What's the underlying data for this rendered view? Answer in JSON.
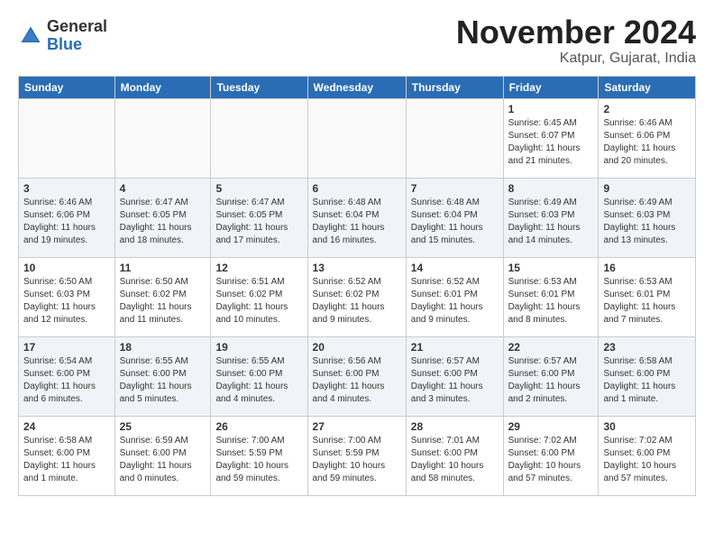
{
  "header": {
    "logo_line1": "General",
    "logo_line2": "Blue",
    "title": "November 2024",
    "subtitle": "Katpur, Gujarat, India"
  },
  "calendar": {
    "days_of_week": [
      "Sunday",
      "Monday",
      "Tuesday",
      "Wednesday",
      "Thursday",
      "Friday",
      "Saturday"
    ],
    "weeks": [
      [
        {
          "day": "",
          "empty": true
        },
        {
          "day": "",
          "empty": true
        },
        {
          "day": "",
          "empty": true
        },
        {
          "day": "",
          "empty": true
        },
        {
          "day": "",
          "empty": true
        },
        {
          "day": "1",
          "sunrise": "Sunrise: 6:45 AM",
          "sunset": "Sunset: 6:07 PM",
          "daylight": "Daylight: 11 hours and 21 minutes."
        },
        {
          "day": "2",
          "sunrise": "Sunrise: 6:46 AM",
          "sunset": "Sunset: 6:06 PM",
          "daylight": "Daylight: 11 hours and 20 minutes."
        }
      ],
      [
        {
          "day": "3",
          "sunrise": "Sunrise: 6:46 AM",
          "sunset": "Sunset: 6:06 PM",
          "daylight": "Daylight: 11 hours and 19 minutes."
        },
        {
          "day": "4",
          "sunrise": "Sunrise: 6:47 AM",
          "sunset": "Sunset: 6:05 PM",
          "daylight": "Daylight: 11 hours and 18 minutes."
        },
        {
          "day": "5",
          "sunrise": "Sunrise: 6:47 AM",
          "sunset": "Sunset: 6:05 PM",
          "daylight": "Daylight: 11 hours and 17 minutes."
        },
        {
          "day": "6",
          "sunrise": "Sunrise: 6:48 AM",
          "sunset": "Sunset: 6:04 PM",
          "daylight": "Daylight: 11 hours and 16 minutes."
        },
        {
          "day": "7",
          "sunrise": "Sunrise: 6:48 AM",
          "sunset": "Sunset: 6:04 PM",
          "daylight": "Daylight: 11 hours and 15 minutes."
        },
        {
          "day": "8",
          "sunrise": "Sunrise: 6:49 AM",
          "sunset": "Sunset: 6:03 PM",
          "daylight": "Daylight: 11 hours and 14 minutes."
        },
        {
          "day": "9",
          "sunrise": "Sunrise: 6:49 AM",
          "sunset": "Sunset: 6:03 PM",
          "daylight": "Daylight: 11 hours and 13 minutes."
        }
      ],
      [
        {
          "day": "10",
          "sunrise": "Sunrise: 6:50 AM",
          "sunset": "Sunset: 6:03 PM",
          "daylight": "Daylight: 11 hours and 12 minutes."
        },
        {
          "day": "11",
          "sunrise": "Sunrise: 6:50 AM",
          "sunset": "Sunset: 6:02 PM",
          "daylight": "Daylight: 11 hours and 11 minutes."
        },
        {
          "day": "12",
          "sunrise": "Sunrise: 6:51 AM",
          "sunset": "Sunset: 6:02 PM",
          "daylight": "Daylight: 11 hours and 10 minutes."
        },
        {
          "day": "13",
          "sunrise": "Sunrise: 6:52 AM",
          "sunset": "Sunset: 6:02 PM",
          "daylight": "Daylight: 11 hours and 9 minutes."
        },
        {
          "day": "14",
          "sunrise": "Sunrise: 6:52 AM",
          "sunset": "Sunset: 6:01 PM",
          "daylight": "Daylight: 11 hours and 9 minutes."
        },
        {
          "day": "15",
          "sunrise": "Sunrise: 6:53 AM",
          "sunset": "Sunset: 6:01 PM",
          "daylight": "Daylight: 11 hours and 8 minutes."
        },
        {
          "day": "16",
          "sunrise": "Sunrise: 6:53 AM",
          "sunset": "Sunset: 6:01 PM",
          "daylight": "Daylight: 11 hours and 7 minutes."
        }
      ],
      [
        {
          "day": "17",
          "sunrise": "Sunrise: 6:54 AM",
          "sunset": "Sunset: 6:00 PM",
          "daylight": "Daylight: 11 hours and 6 minutes."
        },
        {
          "day": "18",
          "sunrise": "Sunrise: 6:55 AM",
          "sunset": "Sunset: 6:00 PM",
          "daylight": "Daylight: 11 hours and 5 minutes."
        },
        {
          "day": "19",
          "sunrise": "Sunrise: 6:55 AM",
          "sunset": "Sunset: 6:00 PM",
          "daylight": "Daylight: 11 hours and 4 minutes."
        },
        {
          "day": "20",
          "sunrise": "Sunrise: 6:56 AM",
          "sunset": "Sunset: 6:00 PM",
          "daylight": "Daylight: 11 hours and 4 minutes."
        },
        {
          "day": "21",
          "sunrise": "Sunrise: 6:57 AM",
          "sunset": "Sunset: 6:00 PM",
          "daylight": "Daylight: 11 hours and 3 minutes."
        },
        {
          "day": "22",
          "sunrise": "Sunrise: 6:57 AM",
          "sunset": "Sunset: 6:00 PM",
          "daylight": "Daylight: 11 hours and 2 minutes."
        },
        {
          "day": "23",
          "sunrise": "Sunrise: 6:58 AM",
          "sunset": "Sunset: 6:00 PM",
          "daylight": "Daylight: 11 hours and 1 minute."
        }
      ],
      [
        {
          "day": "24",
          "sunrise": "Sunrise: 6:58 AM",
          "sunset": "Sunset: 6:00 PM",
          "daylight": "Daylight: 11 hours and 1 minute."
        },
        {
          "day": "25",
          "sunrise": "Sunrise: 6:59 AM",
          "sunset": "Sunset: 6:00 PM",
          "daylight": "Daylight: 11 hours and 0 minutes."
        },
        {
          "day": "26",
          "sunrise": "Sunrise: 7:00 AM",
          "sunset": "Sunset: 5:59 PM",
          "daylight": "Daylight: 10 hours and 59 minutes."
        },
        {
          "day": "27",
          "sunrise": "Sunrise: 7:00 AM",
          "sunset": "Sunset: 5:59 PM",
          "daylight": "Daylight: 10 hours and 59 minutes."
        },
        {
          "day": "28",
          "sunrise": "Sunrise: 7:01 AM",
          "sunset": "Sunset: 6:00 PM",
          "daylight": "Daylight: 10 hours and 58 minutes."
        },
        {
          "day": "29",
          "sunrise": "Sunrise: 7:02 AM",
          "sunset": "Sunset: 6:00 PM",
          "daylight": "Daylight: 10 hours and 57 minutes."
        },
        {
          "day": "30",
          "sunrise": "Sunrise: 7:02 AM",
          "sunset": "Sunset: 6:00 PM",
          "daylight": "Daylight: 10 hours and 57 minutes."
        }
      ]
    ]
  }
}
